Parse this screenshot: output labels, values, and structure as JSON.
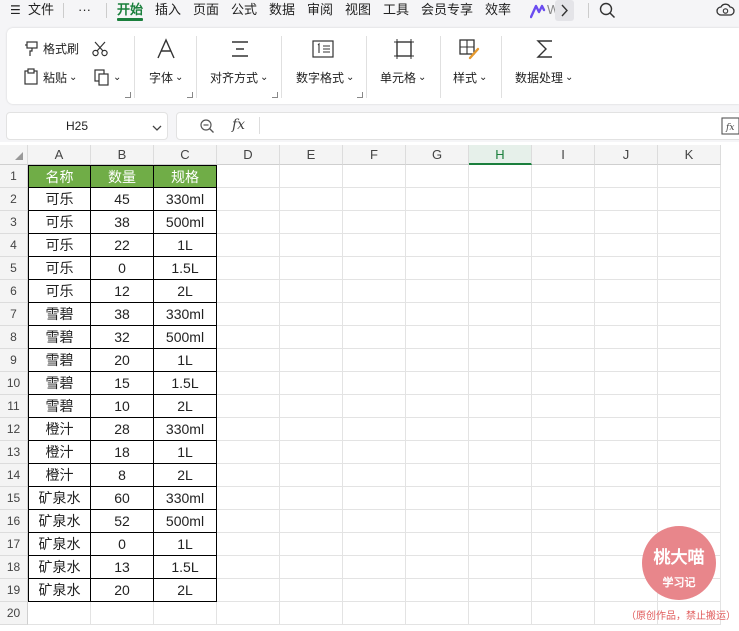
{
  "menu": {
    "items": [
      {
        "label": "文件",
        "active": false
      },
      {
        "label": "开始",
        "active": true
      },
      {
        "label": "插入",
        "active": false
      },
      {
        "label": "页面",
        "active": false
      },
      {
        "label": "公式",
        "active": false
      },
      {
        "label": "数据",
        "active": false
      },
      {
        "label": "审阅",
        "active": false
      },
      {
        "label": "视图",
        "active": false
      },
      {
        "label": "工具",
        "active": false
      },
      {
        "label": "会员专享",
        "active": false
      },
      {
        "label": "效率",
        "active": false
      }
    ],
    "more_label": "···",
    "wps_ai_label": "W"
  },
  "ribbon": {
    "format_painter": "格式刷",
    "paste": "粘贴",
    "font": "字体",
    "align": "对齐方式",
    "number_format": "数字格式",
    "cell": "单元格",
    "style": "样式",
    "data_processing": "数据处理",
    "chevron": "⌄"
  },
  "formula_bar": {
    "name_box": "H25",
    "fx_label": "fx",
    "formula": ""
  },
  "sheet": {
    "columns": [
      "A",
      "B",
      "C",
      "D",
      "E",
      "F",
      "G",
      "H",
      "I",
      "J",
      "K"
    ],
    "selected_column": "H",
    "rows": [
      "1",
      "2",
      "3",
      "4",
      "5",
      "6",
      "7",
      "8",
      "9",
      "10",
      "11",
      "12",
      "13",
      "14",
      "15",
      "16",
      "17",
      "18",
      "19",
      "20"
    ],
    "header_fill": "#70ad47",
    "table": {
      "headers": [
        "名称",
        "数量",
        "规格"
      ],
      "data": [
        [
          "可乐",
          "45",
          "330ml"
        ],
        [
          "可乐",
          "38",
          "500ml"
        ],
        [
          "可乐",
          "22",
          "1L"
        ],
        [
          "可乐",
          "0",
          "1.5L"
        ],
        [
          "可乐",
          "12",
          "2L"
        ],
        [
          "雪碧",
          "38",
          "330ml"
        ],
        [
          "雪碧",
          "32",
          "500ml"
        ],
        [
          "雪碧",
          "20",
          "1L"
        ],
        [
          "雪碧",
          "15",
          "1.5L"
        ],
        [
          "雪碧",
          "10",
          "2L"
        ],
        [
          "橙汁",
          "28",
          "330ml"
        ],
        [
          "橙汁",
          "18",
          "1L"
        ],
        [
          "橙汁",
          "8",
          "2L"
        ],
        [
          "矿泉水",
          "60",
          "330ml"
        ],
        [
          "矿泉水",
          "52",
          "500ml"
        ],
        [
          "矿泉水",
          "0",
          "1L"
        ],
        [
          "矿泉水",
          "13",
          "1.5L"
        ],
        [
          "矿泉水",
          "20",
          "2L"
        ]
      ]
    }
  },
  "watermark": {
    "name": "桃大喵",
    "sub": "学习记",
    "note": "（原创作品，禁止搬运）"
  }
}
